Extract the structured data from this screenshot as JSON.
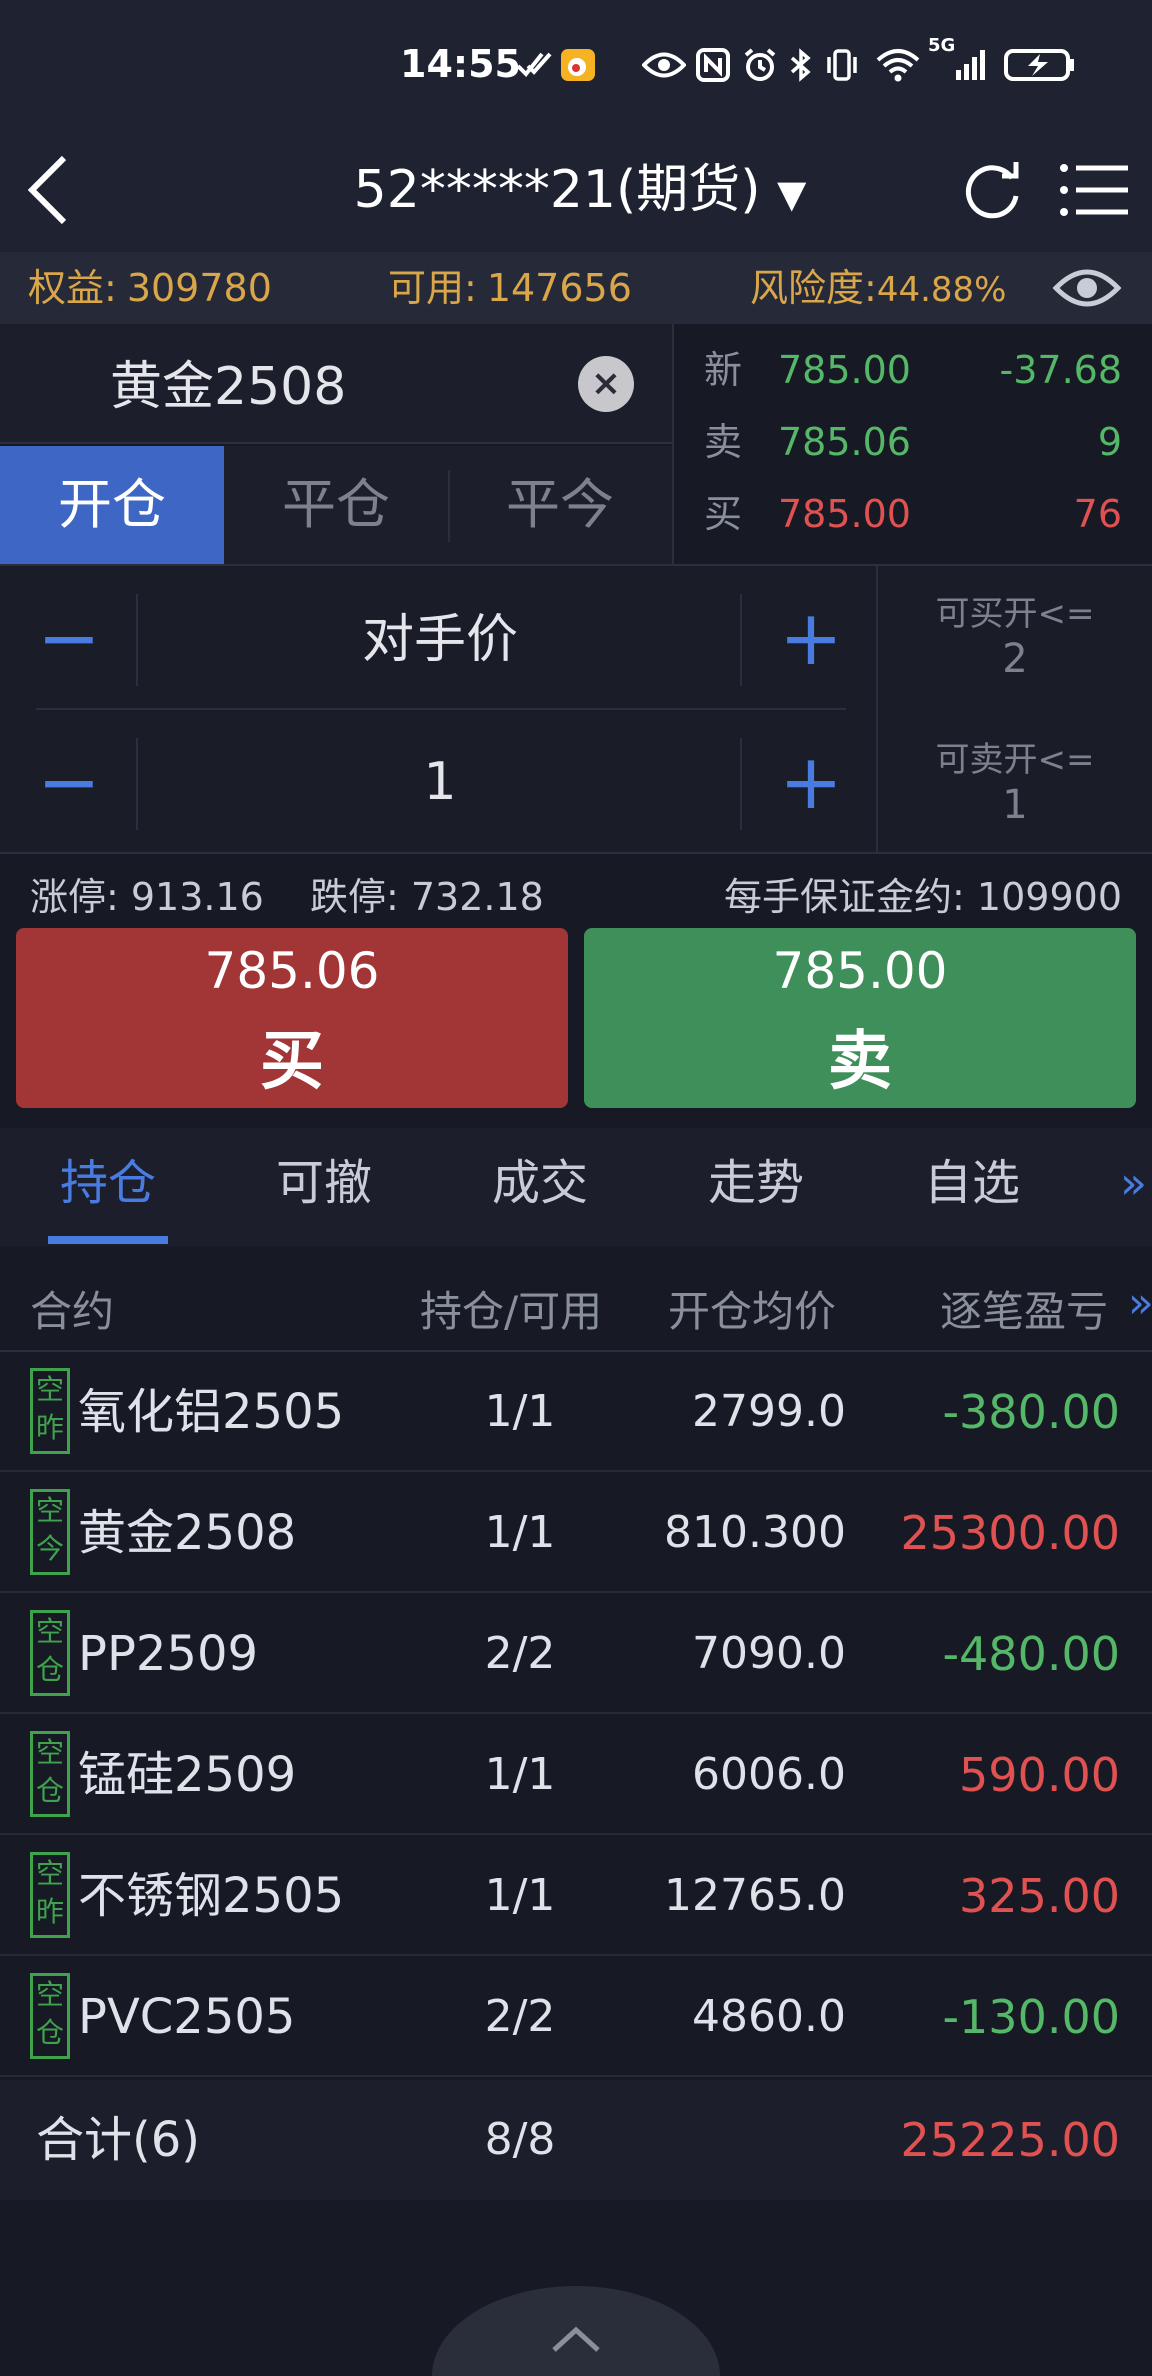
{
  "status_bar": {
    "time": "14:55",
    "icons": [
      "eye-icon",
      "nfc-icon",
      "alarm-icon",
      "bluetooth-icon",
      "vibrate-icon",
      "wifi-icon",
      "signal-5g-icon",
      "battery-icon"
    ],
    "network": "5G"
  },
  "header": {
    "account": "52*****21(期货)",
    "dropdown_arrow": "▼"
  },
  "summary": {
    "equity_label": "权益:",
    "equity_value": "309780",
    "available_label": "可用:",
    "available_value": "147656",
    "risk_label": "风险度:",
    "risk_value": "44.88%"
  },
  "contract": {
    "name": "黄金2508",
    "clear": "×"
  },
  "quotes": [
    {
      "label": "新",
      "price": "785.00",
      "qty": "-37.68",
      "price_color": "#55b868",
      "qty_color": "#55b868"
    },
    {
      "label": "卖",
      "price": "785.06",
      "qty": "9",
      "price_color": "#55b868",
      "qty_color": "#55b868"
    },
    {
      "label": "买",
      "price": "785.00",
      "qty": "76",
      "price_color": "#e05252",
      "qty_color": "#e05252"
    }
  ],
  "order_tabs": {
    "open": "开仓",
    "close": "平仓",
    "close_today": "平今"
  },
  "order_entry": {
    "minus": "−",
    "plus": "+",
    "price_type": "对手价",
    "quantity": "1",
    "can_buy_label": "可买开<=",
    "can_buy_value": "2",
    "can_sell_label": "可卖开<=",
    "can_sell_value": "1"
  },
  "limits": {
    "limit_up": "涨停: 913.16",
    "limit_down": "跌停: 732.18",
    "margin": "每手保证金约: 109900"
  },
  "buy_button": {
    "price": "785.06",
    "label": "买"
  },
  "sell_button": {
    "price": "785.00",
    "label": "卖"
  },
  "bottom_tabs": [
    "持仓",
    "可撤",
    "成交",
    "走势",
    "自选"
  ],
  "bottom_tabs_more": "»",
  "table": {
    "headers": {
      "contract": "合约",
      "position": "持仓/可用",
      "avg_price": "开仓均价",
      "pl": "逐笔盈亏",
      "more": "»"
    },
    "rows": [
      {
        "tag_top": "空",
        "tag_bottom": "昨",
        "contract": "氧化铝2505",
        "position": "1/1",
        "avg_price": "2799.0",
        "pl": "-380.00"
      },
      {
        "tag_top": "空",
        "tag_bottom": "今",
        "contract": "黄金2508",
        "position": "1/1",
        "avg_price": "810.300",
        "pl": "25300.00"
      },
      {
        "tag_top": "空",
        "tag_bottom": "仓",
        "contract": "PP2509",
        "position": "2/2",
        "avg_price": "7090.0",
        "pl": "-480.00"
      },
      {
        "tag_top": "空",
        "tag_bottom": "仓",
        "contract": "锰硅2509",
        "position": "1/1",
        "avg_price": "6006.0",
        "pl": "590.00"
      },
      {
        "tag_top": "空",
        "tag_bottom": "昨",
        "contract": "不锈钢2505",
        "position": "1/1",
        "avg_price": "12765.0",
        "pl": "325.00"
      },
      {
        "tag_top": "空",
        "tag_bottom": "仓",
        "contract": "PVC2505",
        "position": "2/2",
        "avg_price": "4860.0",
        "pl": "-130.00"
      }
    ],
    "total": {
      "label": "合计(6)",
      "position": "8/8",
      "pl": "25225.00"
    }
  },
  "colors": {
    "accent_blue": "#4a7be0",
    "profit_red": "#e05252",
    "loss_green": "#55b868",
    "summary_gold": "#d9a64a"
  }
}
